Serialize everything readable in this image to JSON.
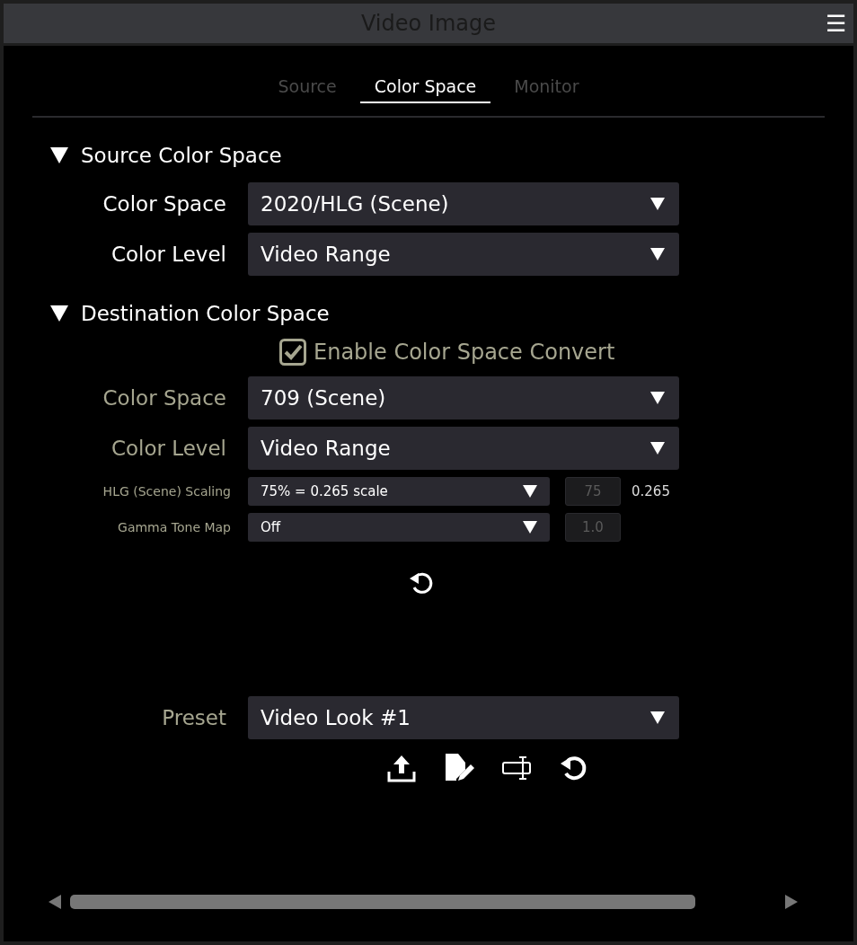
{
  "window": {
    "title": "Video Image",
    "menu_icon": "☰"
  },
  "tabs": [
    {
      "label": "Source",
      "selected": false
    },
    {
      "label": "Color Space",
      "selected": true
    },
    {
      "label": "Monitor",
      "selected": false
    }
  ],
  "sections": [
    {
      "title": "Source Color Space",
      "expanded": true,
      "rows": [
        {
          "kind": "large",
          "label": "Color Space",
          "value": "2020/HLG (Scene)",
          "dimmed": false
        },
        {
          "kind": "large",
          "label": "Color Level",
          "value": "Video Range",
          "dimmed": false
        }
      ]
    },
    {
      "title": "Destination Color Space",
      "expanded": true,
      "checkbox": {
        "label": "Enable Color Space Convert",
        "checked": true
      },
      "rows": [
        {
          "kind": "large",
          "label": "Color Space",
          "value": "709 (Scene)",
          "dimmed": true
        },
        {
          "kind": "large",
          "label": "Color Level",
          "value": "Video Range",
          "dimmed": true
        },
        {
          "kind": "small",
          "label": "HLG (Scene) Scaling",
          "value": "75% = 0.265 scale",
          "number": "75",
          "reading": "0.265",
          "dimmed": true
        },
        {
          "kind": "small",
          "label": "Gamma Tone Map",
          "value": "Off",
          "number": "1.0",
          "dimmed": true
        }
      ]
    }
  ],
  "preset": {
    "label": "Preset",
    "value": "Video Look #1"
  }
}
